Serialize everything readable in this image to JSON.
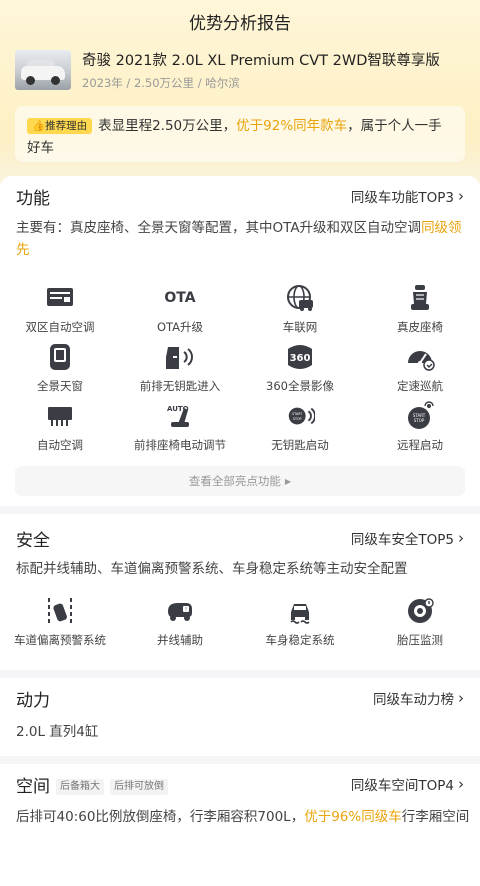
{
  "page": {
    "title": "优势分析报告"
  },
  "car": {
    "name": "奇骏 2021款 2.0L XL Premium CVT 2WD智联尊享版",
    "meta": "2023年 / 2.50万公里 / 哈尔滨"
  },
  "reason": {
    "badge": "推荐理由",
    "text_before": "表显里程2.50万公里，",
    "highlight": "优于92%同年款车",
    "text_after": "，属于个人一手好车"
  },
  "features": {
    "title": "功能",
    "link": "同级车功能TOP3",
    "desc_before": "主要有：真皮座椅、全景天窗等配置，其中OTA升级和双区自动空调",
    "desc_highlight": "同级领先",
    "items": [
      {
        "label": "双区自动空调",
        "icon": "climate-panel-icon"
      },
      {
        "label": "OTA升级",
        "icon": "ota-icon"
      },
      {
        "label": "车联网",
        "icon": "connected-car-icon"
      },
      {
        "label": "真皮座椅",
        "icon": "leather-seat-icon"
      },
      {
        "label": "全景天窗",
        "icon": "sunroof-icon"
      },
      {
        "label": "前排无钥匙进入",
        "icon": "keyless-entry-icon"
      },
      {
        "label": "360全景影像",
        "icon": "camera-360-icon"
      },
      {
        "label": "定速巡航",
        "icon": "cruise-control-icon"
      },
      {
        "label": "自动空调",
        "icon": "auto-ac-icon"
      },
      {
        "label": "前排座椅电动调节",
        "icon": "power-seat-icon"
      },
      {
        "label": "无钥匙启动",
        "icon": "keyless-start-icon"
      },
      {
        "label": "远程启动",
        "icon": "remote-start-icon"
      }
    ],
    "icon_texts": {
      "ota": "OTA",
      "cam360": "360",
      "auto": "AUTO",
      "start": "START",
      "stop": "STOP"
    },
    "view_all": "查看全部亮点功能"
  },
  "safety": {
    "title": "安全",
    "link": "同级车安全TOP5",
    "desc": "标配并线辅助、车道偏离预警系统、车身稳定系统等主动安全配置",
    "items": [
      {
        "label": "车道偏离预警系统",
        "icon": "lane-departure-icon"
      },
      {
        "label": "并线辅助",
        "icon": "blind-spot-icon"
      },
      {
        "label": "车身稳定系统",
        "icon": "stability-control-icon"
      },
      {
        "label": "胎压监测",
        "icon": "tire-pressure-icon"
      }
    ]
  },
  "power": {
    "title": "动力",
    "link": "同级车动力榜",
    "desc": "2.0L 直列4缸"
  },
  "space": {
    "title": "空间",
    "tags": [
      "后备箱大",
      "后排可放倒"
    ],
    "link": "同级车空间TOP4",
    "desc_before": "后排可40:60比例放倒座椅，行李厢容积700L，",
    "desc_highlight": "优于96%同级车",
    "desc_after": "行李厢空间"
  },
  "colors": {
    "accent": "#e8a40c",
    "badge": "#ffd84d",
    "icon": "#3a3d44"
  }
}
